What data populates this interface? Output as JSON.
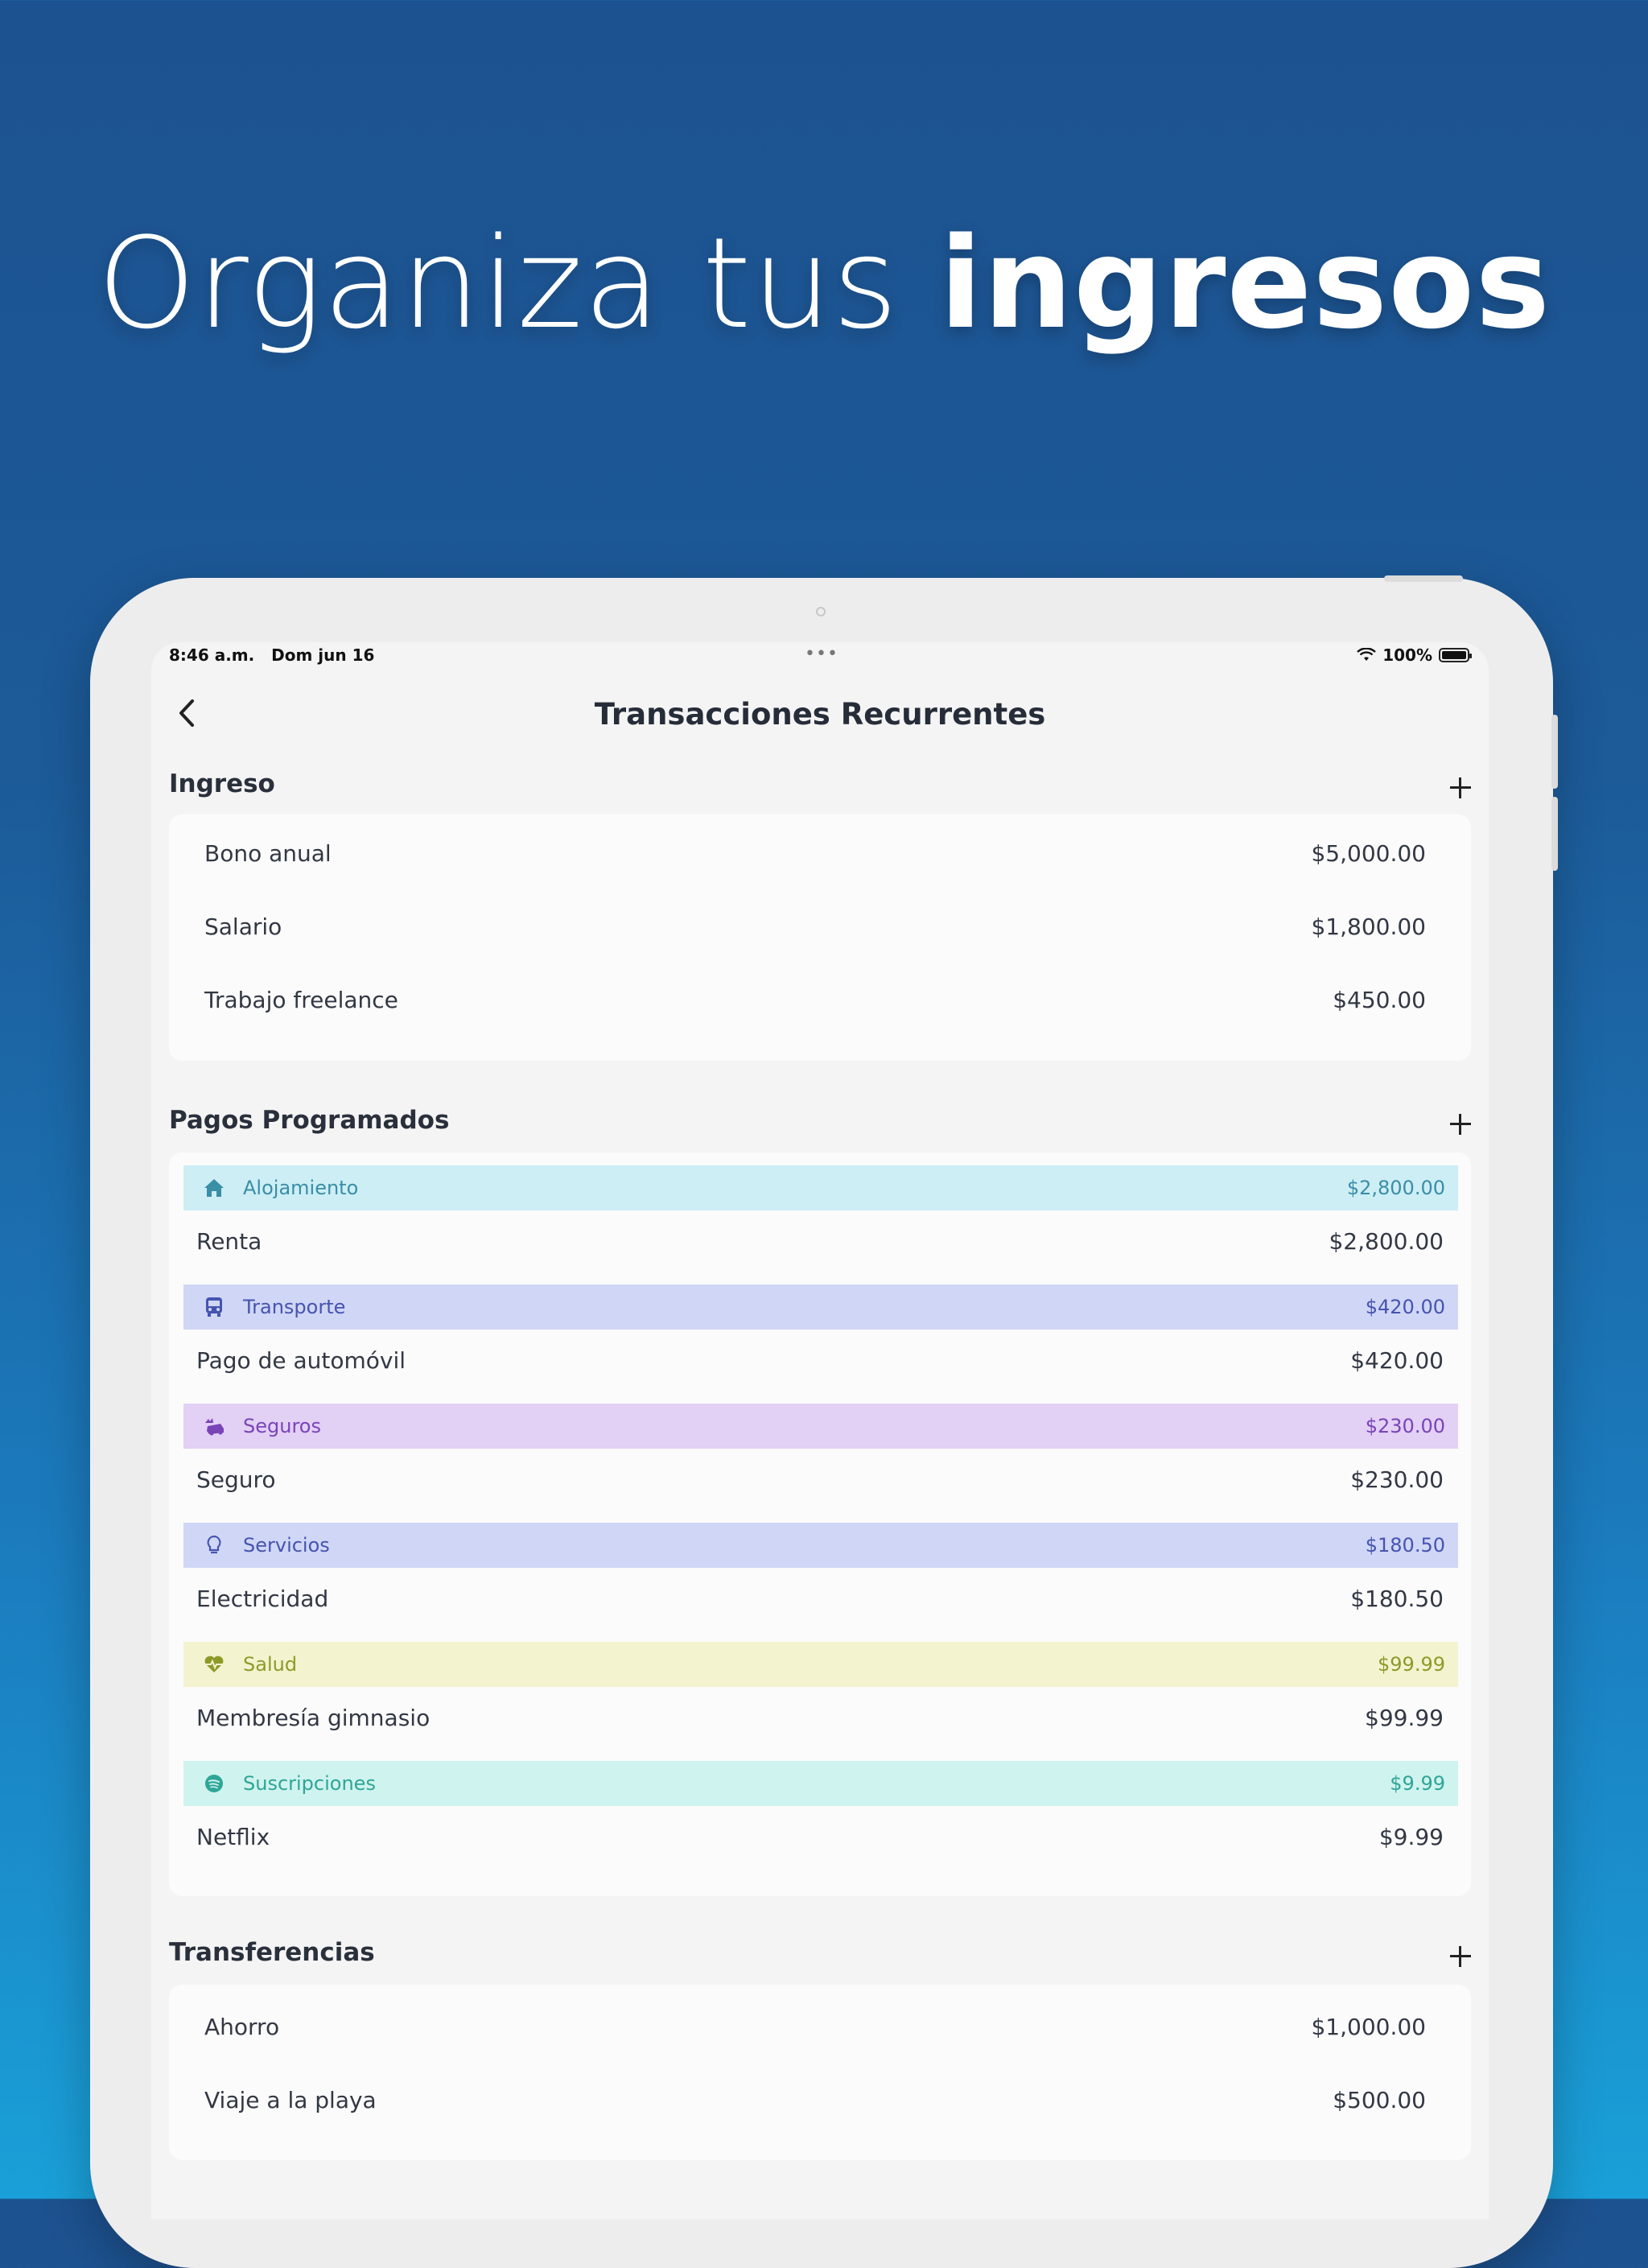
{
  "headline": {
    "light": "Organiza tus ",
    "bold": "ingresos"
  },
  "status_bar": {
    "time": "8:46 a.m.",
    "date": "Dom jun 16",
    "battery": "100%"
  },
  "nav": {
    "title": "Transacciones Recurrentes"
  },
  "income": {
    "title": "Ingreso",
    "items": [
      {
        "label": "Bono anual",
        "amount": "$5,000.00"
      },
      {
        "label": "Salario",
        "amount": "$1,800.00"
      },
      {
        "label": "Trabajo freelance",
        "amount": "$450.00"
      }
    ]
  },
  "payments": {
    "title": "Pagos Programados",
    "groups": [
      {
        "category": "Alojamiento",
        "total": "$2,800.00",
        "icon": "house-icon",
        "bg": "#cdeef5",
        "fg": "#3a8ea6",
        "item": {
          "label": "Renta",
          "amount": "$2,800.00"
        }
      },
      {
        "category": "Transporte",
        "total": "$420.00",
        "icon": "bus-icon",
        "bg": "#d0d6f5",
        "fg": "#4654b0",
        "item": {
          "label": "Pago de automóvil",
          "amount": "$420.00"
        }
      },
      {
        "category": "Seguros",
        "total": "$230.00",
        "icon": "car-crash-icon",
        "bg": "#e2d0f5",
        "fg": "#7a44b8",
        "item": {
          "label": "Seguro",
          "amount": "$230.00"
        }
      },
      {
        "category": "Servicios",
        "total": "$180.50",
        "icon": "lightbulb-icon",
        "bg": "#d0d6f5",
        "fg": "#4654b0",
        "item": {
          "label": "Electricidad",
          "amount": "$180.50"
        }
      },
      {
        "category": "Salud",
        "total": "$99.99",
        "icon": "heart-pulse-icon",
        "bg": "#f3f3cf",
        "fg": "#8e9a28",
        "item": {
          "label": "Membresía gimnasio",
          "amount": "$99.99"
        }
      },
      {
        "category": "Suscripciones",
        "total": "$9.99",
        "icon": "spotify-icon",
        "bg": "#cff3ee",
        "fg": "#2fa597",
        "item": {
          "label": "Netflix",
          "amount": "$9.99"
        }
      }
    ]
  },
  "transfers": {
    "title": "Transferencias",
    "items": [
      {
        "label": "Ahorro",
        "amount": "$1,000.00"
      },
      {
        "label": "Viaje a la playa",
        "amount": "$500.00"
      }
    ]
  }
}
